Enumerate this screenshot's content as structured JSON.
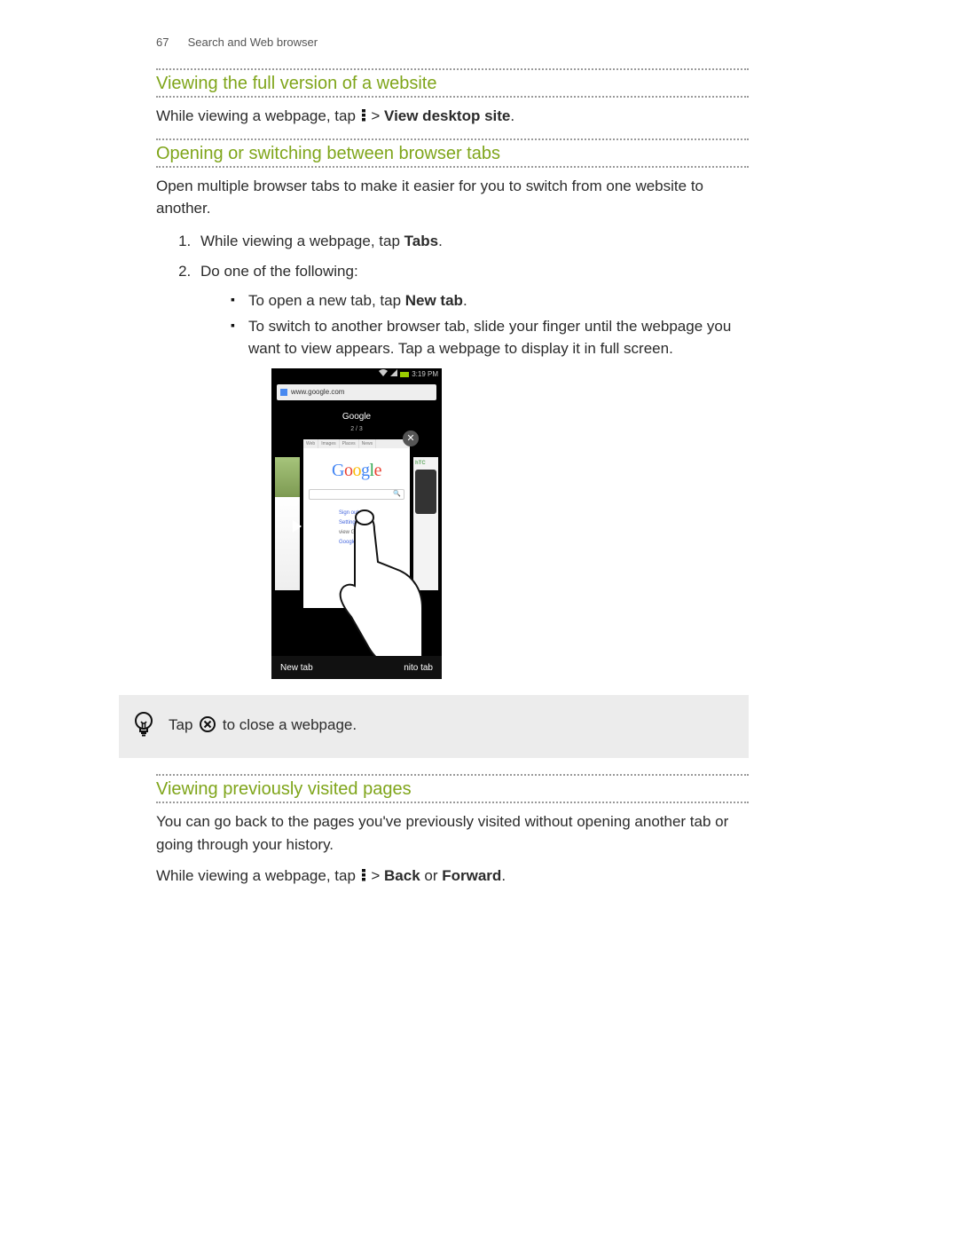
{
  "header": {
    "page_number": "67",
    "section": "Search and Web browser"
  },
  "s1": {
    "title": "Viewing the full version of a website",
    "body_a": "While viewing a webpage, tap ",
    "body_b": " > ",
    "body_c": "View desktop site",
    "body_d": "."
  },
  "s2": {
    "title": "Opening or switching between browser tabs",
    "intro": "Open multiple browser tabs to make it easier for you to switch from one website to another.",
    "step1_a": "While viewing a webpage, tap ",
    "step1_b": "Tabs",
    "step1_c": ".",
    "step2": "Do one of the following:",
    "bullet1_a": "To open a new tab, tap ",
    "bullet1_b": "New tab",
    "bullet1_c": ".",
    "bullet2": "To switch to another browser tab, slide your finger until the webpage you want to view appears. Tap a webpage to display it in full screen."
  },
  "phone": {
    "time": "3:19 PM",
    "url": "www.google.com",
    "tab_title": "Google",
    "tab_count": "2 / 3",
    "new_tab": "New tab",
    "incognito": "nito tab",
    "htc_label": "hTC",
    "mini_tabs": [
      "Web",
      "Images",
      "Places",
      "News"
    ],
    "mini_link1": "Sign out",
    "mini_link2": "Settings",
    "mini_link3": "view Google in:",
    "mini_link4": "Google"
  },
  "tip": {
    "a": "Tap ",
    "b": " to close a webpage."
  },
  "s3": {
    "title": "Viewing previously visited pages",
    "intro": "You can go back to the pages you've previously visited without opening another tab or going through your history.",
    "body_a": "While viewing a webpage, tap ",
    "body_b": " > ",
    "body_c": "Back",
    "body_d": " or ",
    "body_e": "Forward",
    "body_f": "."
  }
}
